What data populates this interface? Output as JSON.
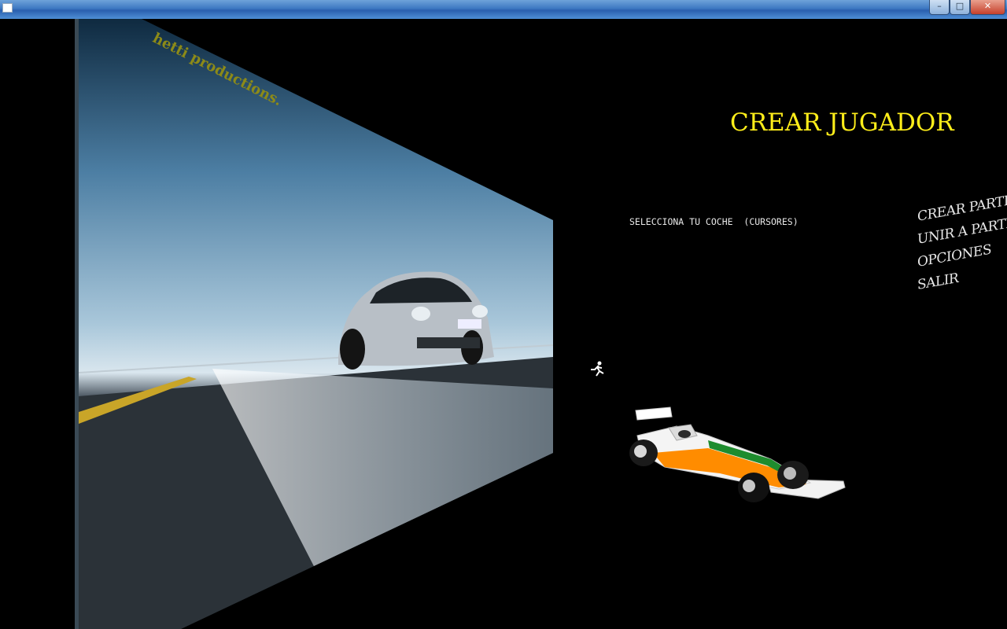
{
  "window": {
    "min_label": "–",
    "max_label": "□",
    "close_label": "✕"
  },
  "game": {
    "studio_text": "hetti productions.",
    "title": "CREAR JUGADOR",
    "car_select_hint": "SELECCIONA TU COCHE  (CURSORES)",
    "menu": [
      {
        "label": "CREAR PARTIDA"
      },
      {
        "label": "UNIR A PARTIDA"
      },
      {
        "label": "OPCIONES"
      },
      {
        "label": "SALIR"
      }
    ]
  },
  "icons": {
    "app": "app-icon",
    "cursor": "runner-cursor-icon",
    "car": "formula-car-icon"
  },
  "colors": {
    "title": "#ffee1a",
    "background": "#000000",
    "car_orange": "#ff8c00",
    "car_green": "#1e8c2e"
  }
}
